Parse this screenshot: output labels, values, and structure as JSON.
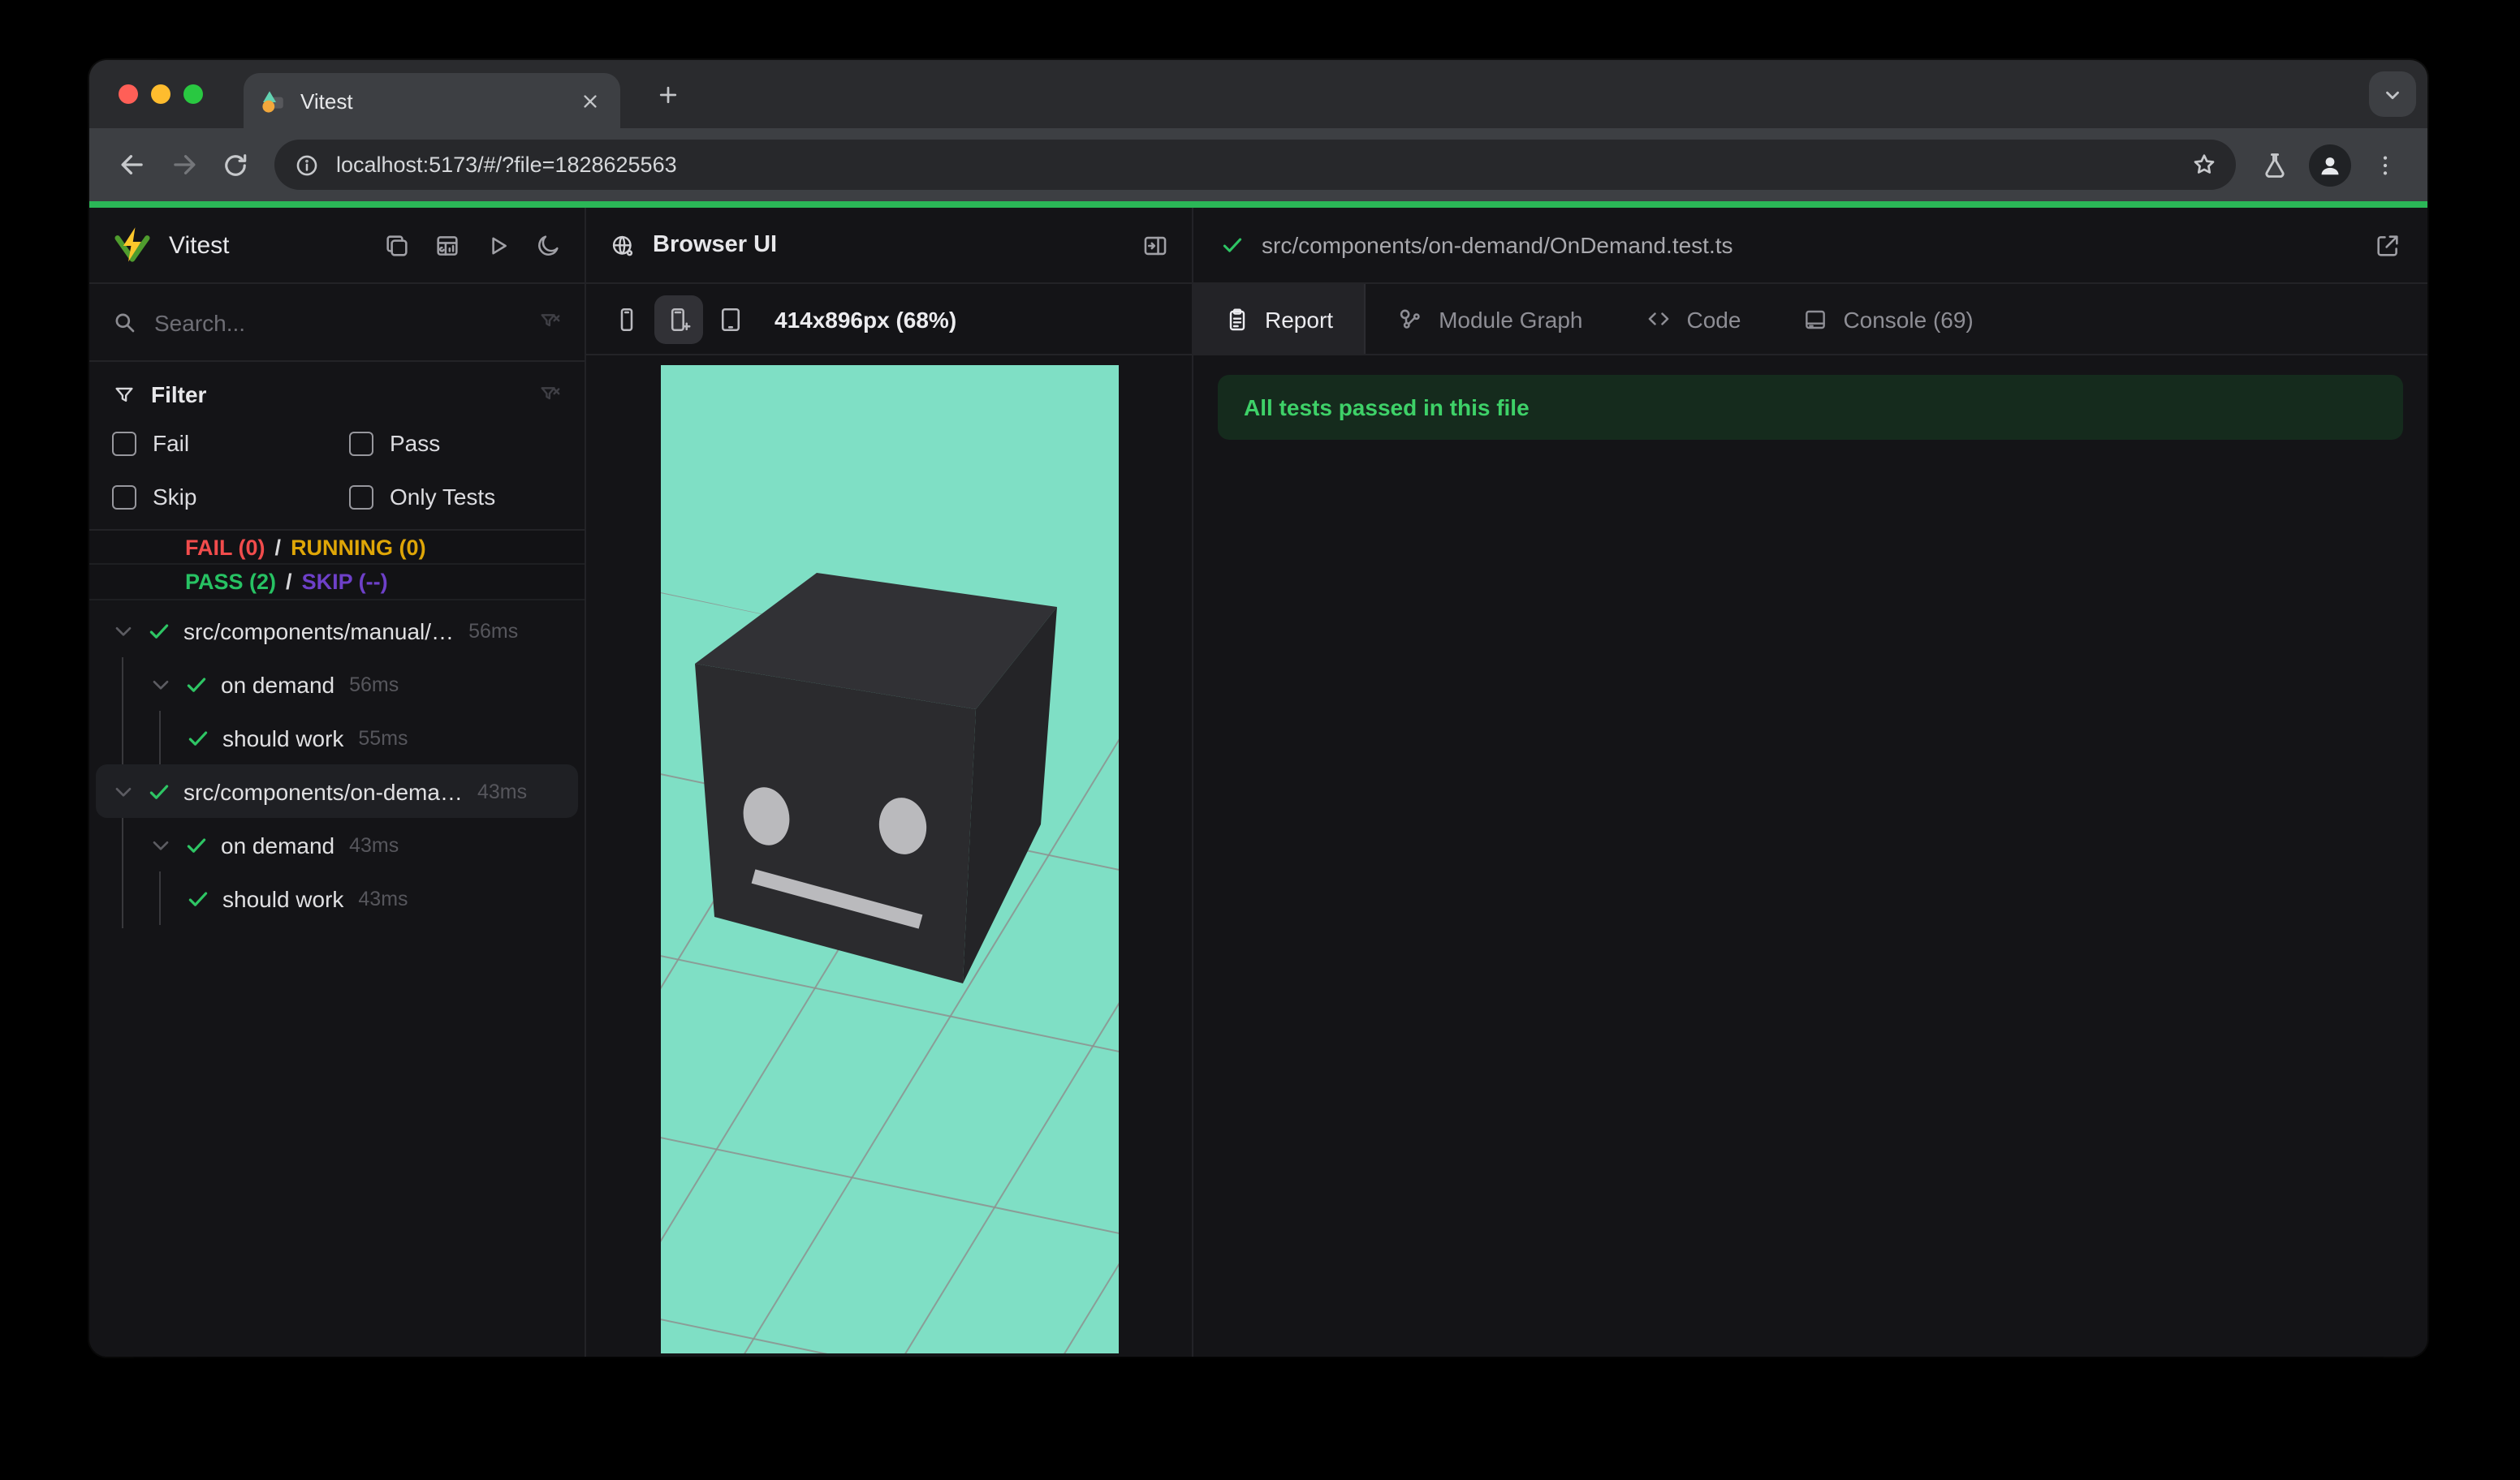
{
  "browser": {
    "tab_title": "Vitest",
    "url": "localhost:5173/#/?file=1828625563",
    "window_controls": [
      "close",
      "minimize",
      "zoom"
    ],
    "toolbar_icons": [
      "back",
      "forward",
      "reload",
      "info",
      "bookmark-star",
      "experiments-flask",
      "profile",
      "menu-kebab"
    ]
  },
  "sidebar": {
    "brand": "Vitest",
    "header_icons": [
      "collapse-panels",
      "dashboard",
      "run-all",
      "dark-mode-moon"
    ],
    "search": {
      "placeholder": "Search...",
      "value": ""
    },
    "filter": {
      "title": "Filter",
      "options": [
        {
          "label": "Fail",
          "checked": false
        },
        {
          "label": "Pass",
          "checked": false
        },
        {
          "label": "Skip",
          "checked": false
        },
        {
          "label": "Only Tests",
          "checked": false
        }
      ]
    },
    "summary": {
      "fail": "FAIL (0)",
      "running": "RUNNING (0)",
      "pass": "PASS (2)",
      "skip": "SKIP (--)",
      "separator": "/"
    },
    "tree": [
      {
        "label": "src/components/manual/…",
        "duration": "56ms",
        "level": 0,
        "status": "pass",
        "expanded": true,
        "selected": false
      },
      {
        "label": "on demand",
        "duration": "56ms",
        "level": 1,
        "status": "pass",
        "expanded": true,
        "selected": false
      },
      {
        "label": "should work",
        "duration": "55ms",
        "level": 2,
        "status": "pass",
        "selected": false
      },
      {
        "label": "src/components/on-dema…",
        "duration": "43ms",
        "level": 0,
        "status": "pass",
        "expanded": true,
        "selected": true
      },
      {
        "label": "on demand",
        "duration": "43ms",
        "level": 1,
        "status": "pass",
        "expanded": true,
        "selected": false
      },
      {
        "label": "should work",
        "duration": "43ms",
        "level": 2,
        "status": "pass",
        "selected": false
      }
    ]
  },
  "preview": {
    "title": "Browser UI",
    "viewport_label": "414x896px (68%)",
    "devices": [
      "phone-small",
      "phone-large",
      "tablet"
    ],
    "active_device": "phone-large"
  },
  "report": {
    "file_path": "src/components/on-demand/OnDemand.test.ts",
    "file_status": "pass",
    "tabs": [
      {
        "label": "Report",
        "active": true
      },
      {
        "label": "Module Graph",
        "active": false
      },
      {
        "label": "Code",
        "active": false
      },
      {
        "label": "Console (69)",
        "active": false
      }
    ],
    "banner": "All tests passed in this file"
  },
  "colors": {
    "accent": "#2bb757",
    "fail": "#f14c4c",
    "running": "#dfa607",
    "pass": "#27c263",
    "skip": "#6e40c9",
    "check": "#2ec564",
    "banner_text": "#3ed168",
    "teal": "#7fdfc5",
    "grid": "#8e928f",
    "cube_front": "#2b2b2e",
    "cube_top": "#313135",
    "cube_side": "#242427",
    "face": "#bababd"
  }
}
